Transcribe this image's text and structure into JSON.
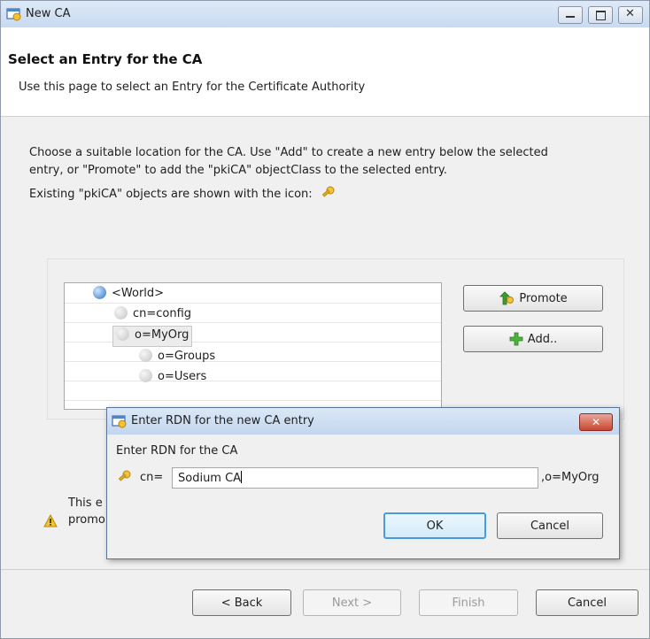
{
  "window": {
    "title": "New CA",
    "icon": "wizard-certificate-icon"
  },
  "window_controls": [
    "minimize-icon",
    "maximize-icon",
    "close-icon"
  ],
  "header": {
    "title": "Select an Entry for the CA",
    "subtitle": "Use this page to select an Entry for the Certificate Authority"
  },
  "description": {
    "line1": "Choose a suitable location for the CA.  Use \"Add\" to create a new entry below the selected",
    "line2": "entry, or \"Promote\" to add the \"pkiCA\" objectClass to the selected entry.",
    "line3": "Existing \"pkiCA\" objects are shown with the icon:"
  },
  "tree": {
    "nodes": [
      {
        "label": "<World>",
        "icon": "globe-icon"
      },
      {
        "label": "cn=config",
        "icon": "ldap-node-icon"
      },
      {
        "label": "o=MyOrg",
        "icon": "ldap-node-icon",
        "selected": true
      },
      {
        "label": "o=Groups",
        "icon": "ldap-node-icon"
      },
      {
        "label": "o=Users",
        "icon": "ldap-node-icon"
      }
    ]
  },
  "buttons": {
    "promote": "Promote",
    "add": "Add.."
  },
  "warning": {
    "line1_fragment": "This e",
    "line2_fragment": "promo"
  },
  "footer": {
    "back": "< Back",
    "next": "Next >",
    "finish": "Finish",
    "cancel": "Cancel"
  },
  "dialog": {
    "title": "Enter RDN for the new CA entry",
    "label": "Enter RDN for the CA",
    "prefix": "cn=",
    "value": "Sodium CA",
    "suffix": ",o=MyOrg",
    "ok": "OK",
    "cancel": "Cancel"
  },
  "colors": {
    "titlebar": "#c9daf0",
    "selection": "#e8e8e8",
    "default_button_border": "#4a9ae0",
    "close_button": "#c9462f"
  }
}
